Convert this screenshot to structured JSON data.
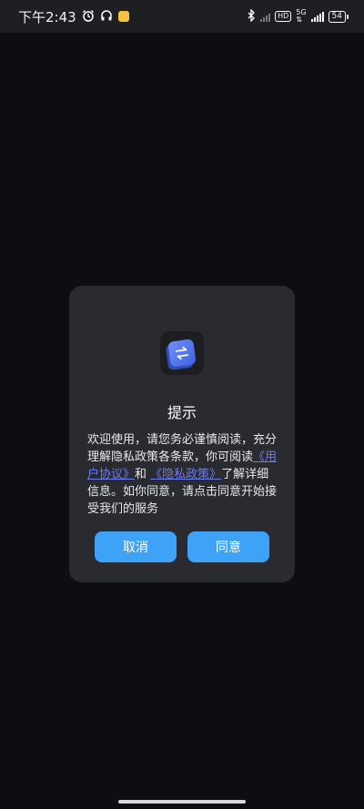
{
  "status_bar": {
    "time": "下午2:43",
    "network_type": "5G",
    "hd": "HD",
    "battery": "54"
  },
  "dialog": {
    "title": "提示",
    "body_part1": "欢迎使用，请您务必谨慎阅读，充分理解隐私政策各条款，你可阅读",
    "link_user_agreement": "《用户协议》",
    "body_and": "和 ",
    "link_privacy_policy": "《隐私政策》",
    "body_part2": "了解详细信息。如你同意，请点击同意开始接受我们的服务",
    "cancel_label": "取消",
    "agree_label": "同意"
  },
  "colors": {
    "accent": "#3ea3f7",
    "link": "#6b7bf2",
    "dialog_bg": "#2a2b31",
    "page_bg": "#0d0e11"
  }
}
